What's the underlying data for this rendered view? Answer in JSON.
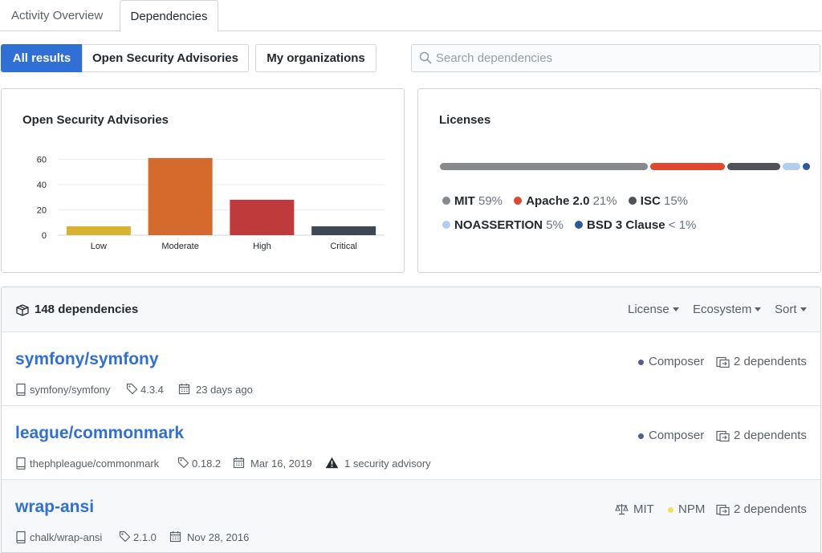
{
  "tabs": [
    {
      "label": "Activity Overview",
      "active": false
    },
    {
      "label": "Dependencies",
      "active": true
    }
  ],
  "filters": {
    "segments": [
      {
        "label": "All results",
        "active": true
      },
      {
        "label": "Open Security Advisories",
        "active": false
      }
    ],
    "my_orgs_label": "My organizations",
    "search_placeholder": "Search dependencies"
  },
  "advisories": {
    "title": "Open Security Advisories"
  },
  "chart_data": {
    "type": "bar",
    "title": "Open Security Advisories",
    "categories": [
      "Low",
      "Moderate",
      "High",
      "Critical"
    ],
    "values": [
      7,
      61,
      28,
      7
    ],
    "colors": [
      "#d8b331",
      "#d46a2c",
      "#bf3a3a",
      "#3f4753"
    ],
    "yticks": [
      0,
      20,
      40,
      60
    ],
    "ylim": [
      0,
      66
    ],
    "grid": true
  },
  "licenses": {
    "title": "Licenses",
    "items": [
      {
        "name": "MIT",
        "pct": "59%",
        "share": 59,
        "color": "#878a8d"
      },
      {
        "name": "Apache 2.0",
        "pct": "21%",
        "share": 21,
        "color": "#e0482f"
      },
      {
        "name": "ISC",
        "pct": "15%",
        "share": 15,
        "color": "#4f5358"
      },
      {
        "name": "NOASSERTION",
        "pct": "5%",
        "share": 5,
        "color": "#b3cdee"
      },
      {
        "name": "BSD 3 Clause",
        "pct": "< 1%",
        "share": 1,
        "color": "#2b5a99"
      }
    ]
  },
  "list": {
    "count_label": "148 dependencies",
    "filters": [
      "License",
      "Ecosystem",
      "Sort"
    ],
    "rows": [
      {
        "name": "symfony/symfony",
        "repo": "symfony/symfony",
        "version": "4.3.4",
        "date": "23 days ago",
        "advisory": "",
        "license": "",
        "ecosystem": "Composer",
        "ecosystem_color": "#4f5d95",
        "dependents": "2 dependents"
      },
      {
        "name": "league/commonmark",
        "repo": "thephpleague/commonmark",
        "version": "0.18.2",
        "date": "Mar 16, 2019",
        "advisory": "1 security advisory",
        "license": "",
        "ecosystem": "Composer",
        "ecosystem_color": "#4f5d95",
        "dependents": "2 dependents"
      },
      {
        "name": "wrap-ansi",
        "repo": "chalk/wrap-ansi",
        "version": "2.1.0",
        "date": "Nov 28, 2016",
        "advisory": "",
        "license": "MIT",
        "ecosystem": "NPM",
        "ecosystem_color": "#f1e05a",
        "dependents": "2 dependents"
      }
    ]
  }
}
